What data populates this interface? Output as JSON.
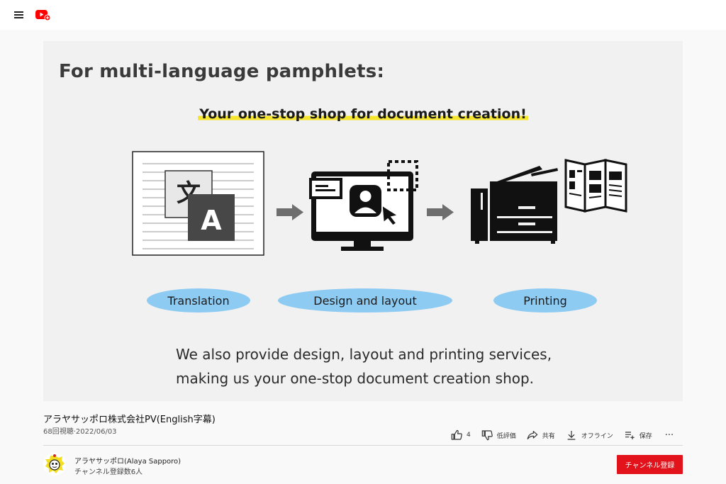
{
  "slide": {
    "heading": "For multi-language pamphlets:",
    "subheading": "Your one-stop shop for document creation!",
    "steps": [
      "Translation",
      "Design and layout",
      "Printing"
    ],
    "translate_glyph_source": "文",
    "translate_glyph_target": "A",
    "body_line1": "We also provide design, layout and printing services,",
    "body_line2": "making us your one-stop document creation shop."
  },
  "video": {
    "title": "アラヤサッポロ株式会社PV(English字幕)",
    "meta": "68回視聴·2022/06/03"
  },
  "actions": {
    "like_count": "4",
    "dislike_label": "低評価",
    "share_label": "共有",
    "offline_label": "オフライン",
    "save_label": "保存",
    "more_label": "···"
  },
  "channel": {
    "name": "アラヤサッポロ(Alaya Sapporo)",
    "subscribers": "チャンネル登録数6人",
    "subscribe_label": "チャンネル登録"
  },
  "icons": [
    "menu-icon",
    "youtube-logo-icon",
    "translate-icon",
    "monitor-icon",
    "arrow-right-icon",
    "copier-icon",
    "pamphlet-icon",
    "thumbs-up-icon",
    "thumbs-down-icon",
    "share-icon",
    "download-icon",
    "playlist-add-icon",
    "more-icon",
    "avatar-icon"
  ],
  "colors": {
    "accent_red": "#e3131b",
    "pill_blue": "#8ecbf3",
    "highlight_yellow": "#f5e52c"
  }
}
